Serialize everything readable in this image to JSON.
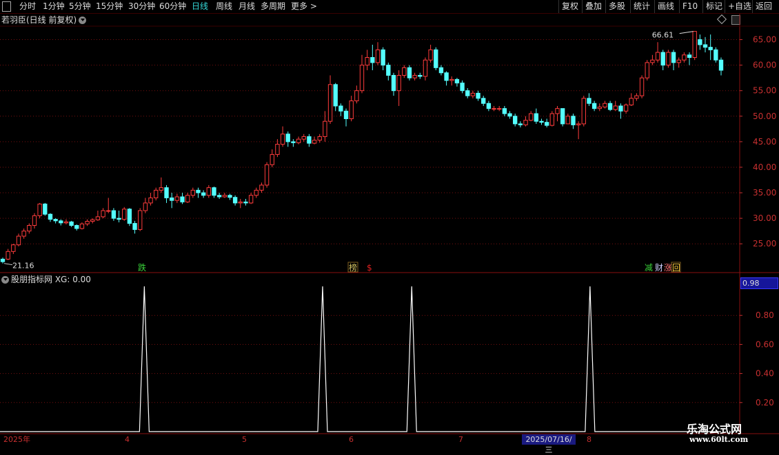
{
  "toolbar": {
    "periods": [
      "分时",
      "1分钟",
      "5分钟",
      "15分钟",
      "30分钟",
      "60分钟",
      "日线",
      "周线",
      "月线",
      "多周期",
      "更多 >"
    ],
    "active_period": "日线",
    "actions": [
      "复权",
      "叠加",
      "多股",
      "统计",
      "画线",
      "F10",
      "标记",
      "+自选",
      "返回"
    ]
  },
  "main_chart": {
    "title": "若羽臣(日线 前复权)",
    "high_label": "66.61",
    "low_label": "21.16"
  },
  "signal_labels": [
    {
      "text": "跌",
      "color": "#3ad23a"
    },
    {
      "text": "榜",
      "color": "#d0c060"
    },
    {
      "text": "$",
      "color": "#e02020"
    },
    {
      "text": "减",
      "color": "#3ad23a"
    },
    {
      "text": "财",
      "color": "#d0d0ff"
    },
    {
      "text": "涨",
      "color": "#ff7070"
    },
    {
      "text": "回",
      "color": "#ffd040"
    }
  ],
  "indicator": {
    "title": "股朋指标网 XG: 0.00",
    "current_value": "0.98"
  },
  "dates": {
    "labels": [
      "2025年",
      "4",
      "5",
      "6",
      "7",
      "8"
    ],
    "highlight": "2025/07/16/三"
  },
  "watermark": {
    "title": "乐淘公式网",
    "url": "www.60lt.com"
  },
  "colors": {
    "up": "#ff3c3c",
    "down": "#54ffff",
    "grid": "#7a1010",
    "axis_text": "#c83030",
    "indicator_line": "#ffffff"
  },
  "chart_data": [
    {
      "type": "candlestick",
      "title": "若羽臣(日线 前复权)",
      "y_ticks": [
        25.0,
        30.0,
        35.0,
        40.0,
        45.0,
        50.0,
        55.0,
        60.0,
        65.0
      ],
      "ylim": [
        19.5,
        67.5
      ],
      "x": [
        "2025年",
        "4",
        "5",
        "6",
        "7",
        "8"
      ],
      "candles": [
        [
          22,
          21.5,
          22.3,
          21.16
        ],
        [
          22,
          23.5,
          24,
          21.8
        ],
        [
          23.5,
          24.8,
          25,
          23
        ],
        [
          24.8,
          26.5,
          27,
          24.5
        ],
        [
          26.5,
          27.5,
          28,
          26
        ],
        [
          27.5,
          28.6,
          29,
          27
        ],
        [
          28.6,
          30.5,
          31,
          28
        ],
        [
          30.5,
          32.8,
          33,
          30
        ],
        [
          32.8,
          30.8,
          33,
          30.5
        ],
        [
          30.8,
          29.8,
          31,
          29.3
        ],
        [
          29.8,
          29.5,
          30,
          29
        ],
        [
          29.5,
          29.1,
          29.8,
          28.6
        ],
        [
          29.1,
          29.3,
          29.8,
          28.8
        ],
        [
          29.3,
          28.6,
          29.5,
          28.3
        ],
        [
          28.6,
          28,
          28.8,
          27.6
        ],
        [
          28,
          28.9,
          29.2,
          27.8
        ],
        [
          28.9,
          29.4,
          29.8,
          28.5
        ],
        [
          29.4,
          29.7,
          30,
          29
        ],
        [
          29.7,
          30.3,
          31.5,
          29.5
        ],
        [
          30.3,
          31.5,
          32,
          30
        ],
        [
          31.5,
          31.5,
          34,
          31
        ],
        [
          31.5,
          30,
          32,
          29.5
        ],
        [
          30,
          29.8,
          31.5,
          29.2
        ],
        [
          29.8,
          31.8,
          32.2,
          29.5
        ],
        [
          31.8,
          29,
          32,
          28.5
        ],
        [
          29,
          27.8,
          29.5,
          27
        ],
        [
          27.8,
          31.5,
          32,
          27.5
        ],
        [
          31.5,
          33,
          34,
          31
        ],
        [
          33,
          34,
          35,
          32.5
        ],
        [
          34,
          35.5,
          36,
          33.5
        ],
        [
          35.5,
          36,
          38,
          35
        ],
        [
          36,
          34,
          36.5,
          33
        ],
        [
          34,
          33.5,
          35,
          32
        ],
        [
          33.5,
          34.2,
          34.8,
          33
        ],
        [
          34.2,
          33.2,
          35,
          32.8
        ],
        [
          33.2,
          34.5,
          35,
          33
        ],
        [
          34.5,
          35.5,
          36,
          34
        ],
        [
          35.5,
          35,
          36,
          34
        ],
        [
          35,
          34.5,
          35.5,
          34
        ],
        [
          34.5,
          36,
          36.5,
          34
        ],
        [
          36,
          34.5,
          36.2,
          34
        ],
        [
          34.5,
          34.2,
          35,
          33.8
        ],
        [
          34.2,
          34.5,
          35,
          34
        ],
        [
          34.5,
          34.1,
          34.8,
          33.6
        ],
        [
          34.1,
          33,
          34.5,
          32.5
        ],
        [
          33,
          33.2,
          33.8,
          32
        ],
        [
          33.2,
          33,
          33.8,
          32.5
        ],
        [
          33,
          34.5,
          35,
          32.8
        ],
        [
          34.5,
          35.5,
          36,
          34
        ],
        [
          35.5,
          36.5,
          37,
          35
        ],
        [
          36.5,
          40.5,
          41,
          36
        ],
        [
          40.5,
          42.5,
          43.5,
          40
        ],
        [
          42.5,
          44.5,
          45.5,
          42
        ],
        [
          44.5,
          46.5,
          48,
          44
        ],
        [
          46.5,
          45,
          47,
          44
        ],
        [
          45,
          44.8,
          45.5,
          44
        ],
        [
          44.8,
          45.5,
          46,
          44.5
        ],
        [
          45.5,
          46,
          46.5,
          45
        ],
        [
          46,
          44.7,
          46.5,
          44
        ],
        [
          44.7,
          45.3,
          46,
          44.5
        ],
        [
          45.3,
          46,
          46.5,
          44.8
        ],
        [
          46,
          49,
          51,
          45
        ],
        [
          49,
          56.2,
          58,
          48.5
        ],
        [
          56.2,
          52,
          56.5,
          51
        ],
        [
          52,
          51,
          52.5,
          50
        ],
        [
          51,
          49.5,
          51.5,
          48
        ],
        [
          49.5,
          53,
          54,
          49
        ],
        [
          53,
          55,
          56,
          52.5
        ],
        [
          55,
          60,
          62,
          54.5
        ],
        [
          60,
          61.5,
          63,
          59
        ],
        [
          61.5,
          60.5,
          64,
          59
        ],
        [
          60.5,
          63,
          64.5,
          60
        ],
        [
          63,
          60,
          63.5,
          59
        ],
        [
          60,
          58,
          60.5,
          57
        ],
        [
          58,
          55,
          58.5,
          54
        ],
        [
          55,
          58,
          59,
          52
        ],
        [
          58,
          59.5,
          60,
          57.5
        ],
        [
          59.5,
          57.5,
          60,
          57
        ],
        [
          57.5,
          58,
          58.5,
          57
        ],
        [
          58,
          57.8,
          58.5,
          57.3
        ],
        [
          57.8,
          61,
          61.5,
          57
        ],
        [
          61,
          63,
          64,
          60.5
        ],
        [
          63,
          59.5,
          63.5,
          59
        ],
        [
          59.5,
          58.5,
          60,
          58
        ],
        [
          58.5,
          57,
          58.8,
          56
        ],
        [
          57,
          57.2,
          57.8,
          56
        ],
        [
          57.2,
          56.5,
          57.5,
          55.8
        ],
        [
          56.5,
          55,
          57,
          54.5
        ],
        [
          55,
          54,
          55.5,
          53.5
        ],
        [
          54,
          54.5,
          55,
          53.5
        ],
        [
          54.5,
          53.5,
          55,
          53
        ],
        [
          53.5,
          52.5,
          54,
          52
        ],
        [
          52.5,
          51.5,
          53,
          51
        ],
        [
          51.5,
          51.5,
          52,
          51
        ],
        [
          51.5,
          51.5,
          52,
          51
        ],
        [
          51.5,
          50.5,
          52,
          50
        ],
        [
          50.5,
          50,
          51,
          49.5
        ],
        [
          50,
          48.5,
          50.5,
          48
        ],
        [
          48.5,
          48.3,
          49,
          47.8
        ],
        [
          48.3,
          49.2,
          50,
          48
        ],
        [
          49.2,
          50.5,
          51,
          49
        ],
        [
          50.5,
          49,
          51.5,
          48.5
        ],
        [
          49,
          48.8,
          49.5,
          48.3
        ],
        [
          48.8,
          48.2,
          49.5,
          47.8
        ],
        [
          48.2,
          50.5,
          51,
          48
        ],
        [
          50.5,
          51.5,
          52,
          49
        ],
        [
          51.5,
          48.5,
          51.5,
          48
        ],
        [
          48.5,
          50,
          50.5,
          48.5
        ],
        [
          50,
          48.3,
          50.5,
          47.5
        ],
        [
          48.3,
          48.5,
          49,
          45.5
        ],
        [
          48.5,
          53.5,
          54,
          48
        ],
        [
          53.5,
          52.5,
          54.5,
          52
        ],
        [
          52.5,
          51.5,
          53,
          51
        ],
        [
          51.5,
          51.8,
          52.5,
          51
        ],
        [
          51.8,
          52.5,
          53,
          51.5
        ],
        [
          52.5,
          51.3,
          53,
          51
        ],
        [
          51.3,
          52,
          53,
          51
        ],
        [
          52,
          51,
          52.5,
          49.5
        ],
        [
          51,
          52.2,
          52.5,
          50.5
        ],
        [
          52.2,
          53.5,
          54.5,
          52
        ],
        [
          53.5,
          54,
          54.5,
          53
        ],
        [
          54,
          57.5,
          58,
          53.5
        ],
        [
          57.5,
          60.5,
          61,
          57
        ],
        [
          60.5,
          61,
          62,
          60
        ],
        [
          61,
          62.5,
          64.5,
          60.5
        ],
        [
          62.5,
          60,
          63,
          59
        ],
        [
          60,
          62.5,
          63,
          59.5
        ],
        [
          62.5,
          60.5,
          63,
          59
        ],
        [
          60.5,
          61,
          61.5,
          59.5
        ],
        [
          61,
          62,
          62.5,
          60.5
        ],
        [
          62,
          61.5,
          62.5,
          60
        ],
        [
          61.5,
          66.61,
          66.61,
          61
        ],
        [
          65,
          64,
          66,
          63
        ],
        [
          64,
          63.5,
          65.5,
          62.5
        ],
        [
          63.5,
          63,
          66,
          61
        ],
        [
          63,
          61,
          63.5,
          60.5
        ],
        [
          61,
          59,
          61.5,
          58
        ]
      ]
    },
    {
      "type": "line",
      "title": "股朋指标网 XG: 0.00",
      "y_ticks": [
        0.2,
        0.4,
        0.6,
        0.8
      ],
      "ylim": [
        0,
        1.0
      ],
      "series": [
        {
          "values": [
            0,
            0,
            0,
            0,
            0,
            0,
            0,
            0,
            0,
            0,
            0,
            0,
            0,
            0,
            0,
            0,
            0,
            0,
            0,
            0,
            0,
            0,
            0,
            0,
            0,
            0,
            0,
            0,
            0,
            0,
            0,
            0,
            0,
            0,
            0,
            0,
            0,
            0,
            0,
            0,
            0,
            0,
            0,
            0,
            0,
            0,
            0,
            0,
            0,
            0,
            0,
            0,
            0,
            0,
            0,
            0,
            0,
            0,
            0,
            0,
            0,
            0,
            0,
            0,
            0,
            0,
            0,
            0,
            0,
            0,
            0,
            0,
            0,
            0,
            0,
            0,
            0,
            0,
            0,
            0,
            0,
            0,
            0,
            0,
            0,
            0,
            0,
            0,
            0,
            0,
            0,
            0,
            0,
            0,
            0,
            0,
            0,
            0,
            0,
            0,
            0,
            0,
            0,
            0,
            0,
            0,
            0,
            0,
            0,
            0,
            0,
            0,
            0,
            0,
            0,
            0,
            0,
            0,
            0,
            0,
            0,
            0,
            0,
            0,
            0,
            0,
            0,
            0,
            0,
            0,
            0,
            0,
            0,
            0,
            0,
            0,
            0,
            0
          ],
          "peaks": [
            27,
            61,
            78,
            112
          ]
        }
      ]
    }
  ]
}
